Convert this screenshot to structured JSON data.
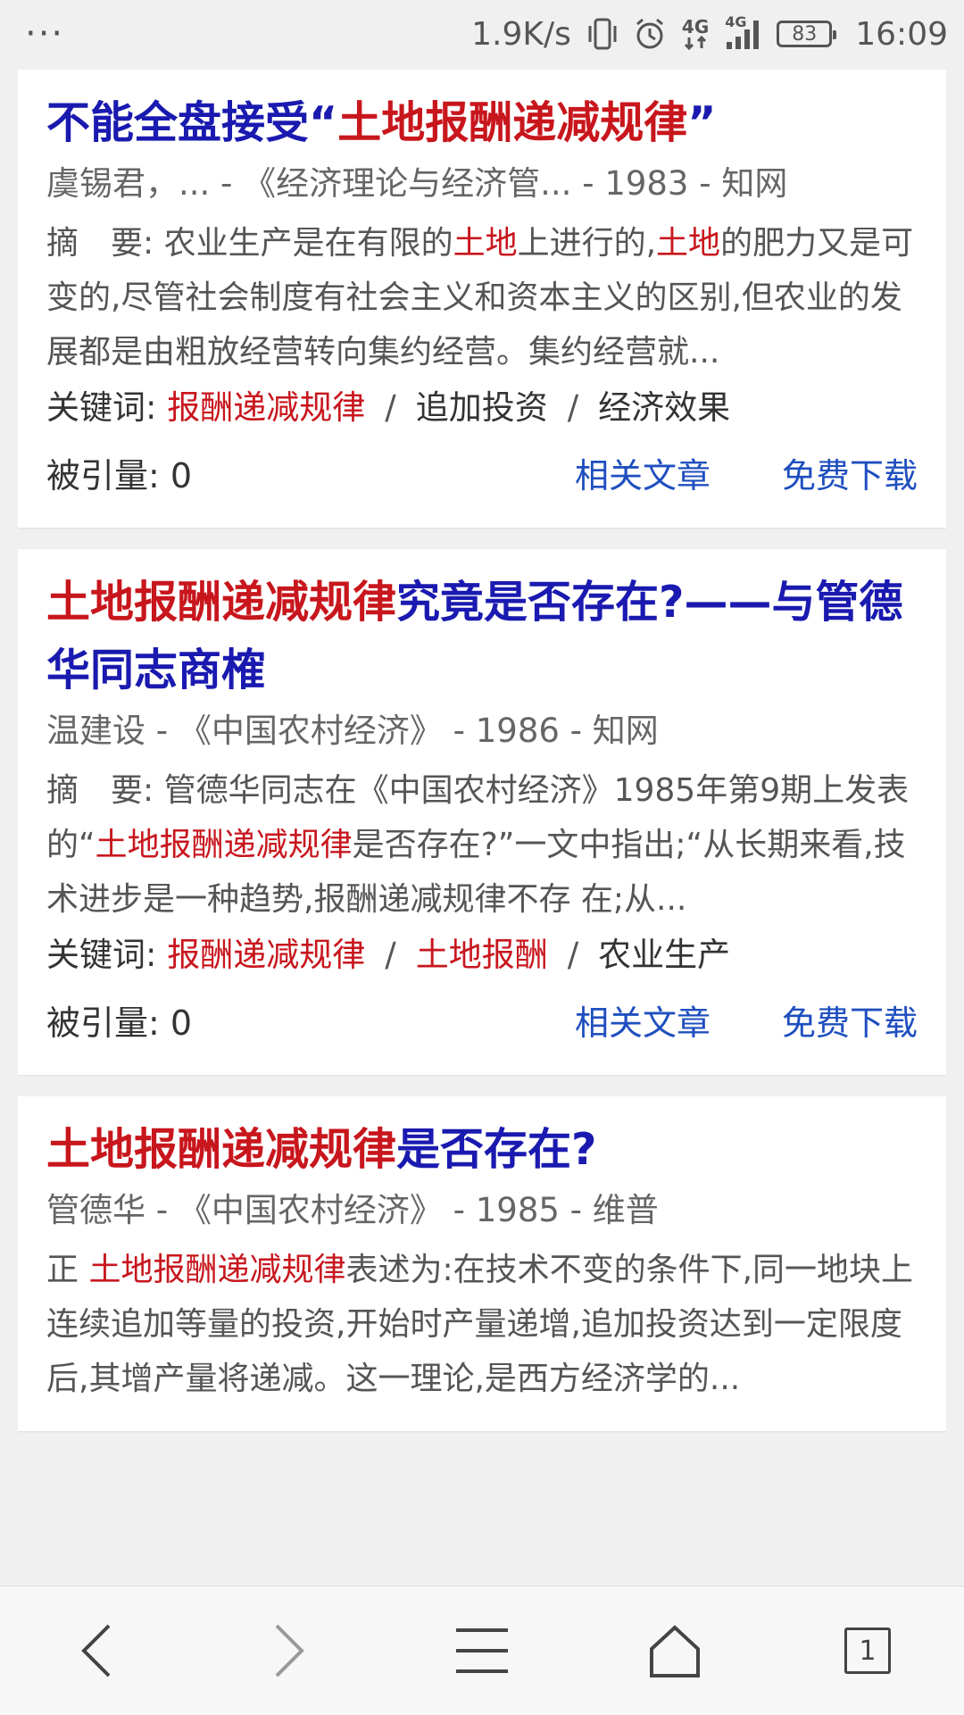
{
  "status_bar": {
    "menu": "···",
    "speed": "1.9K/s",
    "network_left": "4G",
    "network_right": "4G",
    "battery": "83",
    "time": "16:09"
  },
  "results": [
    {
      "title_parts": [
        "不能全盘接受“",
        "土地报酬递减规律",
        "”"
      ],
      "meta": "虞锡君，... - 《经济理论与经济管... - 1983  -  知网",
      "abstract_parts": [
        "摘　要: 农业生产是在有限的",
        "土地",
        "上进行的,",
        "土地",
        "的肥力又是可变的,尽管社会制度有社会主义和资本主义的区别,但农业的发展都是由粗放经营转向集约经营。集约经营就..."
      ],
      "keywords_label": "关键词:",
      "keywords": [
        "报酬递减规律",
        "追加投资",
        "经济效果"
      ],
      "citations": "被引量: 0",
      "related": "相关文章",
      "download": "免费下载"
    },
    {
      "title_parts": [
        "土地报酬递减规律",
        "究竟是否存在?——与管德华同志商榷"
      ],
      "meta": "温建设  -  《中国农村经济》 - 1986  -  知网",
      "abstract_parts": [
        "摘　要: 管德华同志在《中国农村经济》1985年第9期上发表的“",
        "土地报酬递减规律",
        "是否存在?”一文中指出;“从长期来看,技术进步是一种趋势,报酬递减规律不存 在;从..."
      ],
      "keywords_label": "关键词:",
      "keywords": [
        "报酬递减规律",
        "土地报酬",
        "农业生产"
      ],
      "citations": "被引量: 0",
      "related": "相关文章",
      "download": "免费下载"
    },
    {
      "title_parts": [
        "土地报酬递减规律",
        "是否存在?"
      ],
      "meta": "管德华  -  《中国农村经济》 - 1985  -  维普",
      "abstract_parts": [
        "正 ",
        "土地报酬递减规律",
        "表述为:在技术不变的条件下,同一地块上连续追加等量的投资,开始时产量递增,追加投资达到一定限度后,其增产量将递减。这一理论,是西方经济学的..."
      ]
    }
  ],
  "nav": {
    "tab_count": "1"
  },
  "colors": {
    "title_blue": "#1a1ab0",
    "highlight_red": "#c8161d",
    "link_blue": "#1f4fbf"
  }
}
